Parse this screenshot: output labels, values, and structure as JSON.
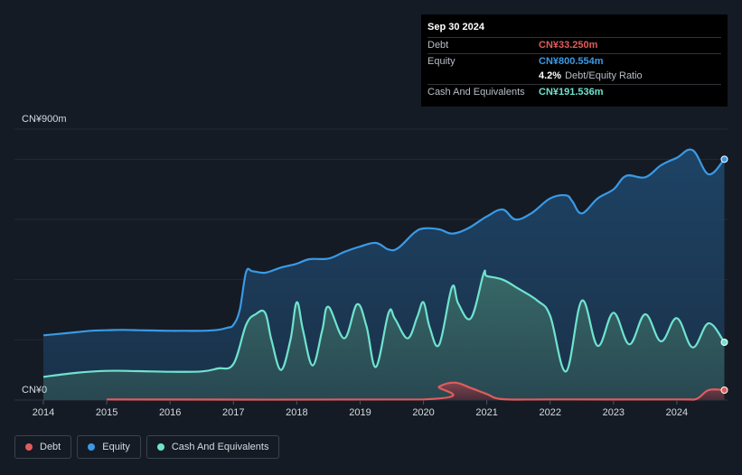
{
  "tooltip": {
    "date": "Sep 30 2024",
    "rows": [
      {
        "label": "Debt",
        "value": "CN¥33.250m",
        "color": "#e05c5c"
      },
      {
        "label": "Equity",
        "value": "CN¥800.554m",
        "color": "#3a9ae6"
      },
      {
        "label": "",
        "value": "4.2%",
        "suffix": "Debt/Equity Ratio",
        "color": "#ffffff"
      },
      {
        "label": "Cash And Equivalents",
        "value": "CN¥191.536m",
        "color": "#6fe3cf"
      }
    ]
  },
  "legend": [
    {
      "label": "Debt",
      "color": "#e05c5c"
    },
    {
      "label": "Equity",
      "color": "#3a9ae6"
    },
    {
      "label": "Cash And Equivalents",
      "color": "#6fe3cf"
    }
  ],
  "chart_data": {
    "type": "area",
    "y_top_label": "CN¥900m",
    "y_zero_label": "CN¥0",
    "ylim": [
      0,
      900
    ],
    "xlim": [
      2014.0,
      2024.8
    ],
    "x_ticks": [
      "2014",
      "2015",
      "2016",
      "2017",
      "2018",
      "2019",
      "2020",
      "2021",
      "2022",
      "2023",
      "2024"
    ],
    "series": [
      {
        "name": "Equity",
        "color": "#3a9ae6",
        "points": [
          [
            2014.0,
            215
          ],
          [
            2014.25,
            220
          ],
          [
            2014.5,
            225
          ],
          [
            2014.75,
            230
          ],
          [
            2015.0,
            232
          ],
          [
            2015.25,
            233
          ],
          [
            2015.5,
            232
          ],
          [
            2015.75,
            231
          ],
          [
            2016.0,
            230
          ],
          [
            2016.25,
            230
          ],
          [
            2016.5,
            230
          ],
          [
            2016.75,
            233
          ],
          [
            2016.9,
            240
          ],
          [
            2017.0,
            250
          ],
          [
            2017.1,
            300
          ],
          [
            2017.2,
            425
          ],
          [
            2017.3,
            428
          ],
          [
            2017.5,
            423
          ],
          [
            2017.75,
            440
          ],
          [
            2018.0,
            453
          ],
          [
            2018.2,
            468
          ],
          [
            2018.5,
            470
          ],
          [
            2018.75,
            492
          ],
          [
            2019.0,
            510
          ],
          [
            2019.25,
            522
          ],
          [
            2019.45,
            500
          ],
          [
            2019.6,
            505
          ],
          [
            2019.85,
            555
          ],
          [
            2020.0,
            570
          ],
          [
            2020.25,
            567
          ],
          [
            2020.45,
            553
          ],
          [
            2020.7,
            570
          ],
          [
            2021.0,
            610
          ],
          [
            2021.25,
            633
          ],
          [
            2021.45,
            600
          ],
          [
            2021.7,
            620
          ],
          [
            2022.0,
            670
          ],
          [
            2022.25,
            680
          ],
          [
            2022.35,
            660
          ],
          [
            2022.5,
            620
          ],
          [
            2022.75,
            670
          ],
          [
            2023.0,
            700
          ],
          [
            2023.2,
            745
          ],
          [
            2023.5,
            740
          ],
          [
            2023.75,
            780
          ],
          [
            2024.0,
            805
          ],
          [
            2024.25,
            830
          ],
          [
            2024.5,
            750
          ],
          [
            2024.75,
            800
          ]
        ]
      },
      {
        "name": "Cash And Equivalents",
        "color": "#6fe3cf",
        "points": [
          [
            2014.0,
            77
          ],
          [
            2014.5,
            90
          ],
          [
            2015.0,
            97
          ],
          [
            2015.5,
            96
          ],
          [
            2016.0,
            94
          ],
          [
            2016.5,
            95
          ],
          [
            2016.75,
            105
          ],
          [
            2017.0,
            120
          ],
          [
            2017.2,
            250
          ],
          [
            2017.35,
            285
          ],
          [
            2017.5,
            290
          ],
          [
            2017.6,
            200
          ],
          [
            2017.75,
            100
          ],
          [
            2017.9,
            200
          ],
          [
            2018.0,
            325
          ],
          [
            2018.1,
            230
          ],
          [
            2018.25,
            115
          ],
          [
            2018.4,
            230
          ],
          [
            2018.5,
            310
          ],
          [
            2018.75,
            205
          ],
          [
            2018.95,
            318
          ],
          [
            2019.1,
            245
          ],
          [
            2019.25,
            110
          ],
          [
            2019.45,
            290
          ],
          [
            2019.55,
            270
          ],
          [
            2019.75,
            205
          ],
          [
            2019.9,
            275
          ],
          [
            2020.0,
            325
          ],
          [
            2020.1,
            240
          ],
          [
            2020.25,
            185
          ],
          [
            2020.45,
            375
          ],
          [
            2020.55,
            320
          ],
          [
            2020.75,
            272
          ],
          [
            2020.95,
            420
          ],
          [
            2021.0,
            412
          ],
          [
            2021.25,
            400
          ],
          [
            2021.5,
            370
          ],
          [
            2021.8,
            330
          ],
          [
            2022.0,
            280
          ],
          [
            2022.25,
            95
          ],
          [
            2022.5,
            330
          ],
          [
            2022.75,
            180
          ],
          [
            2023.0,
            290
          ],
          [
            2023.25,
            185
          ],
          [
            2023.5,
            285
          ],
          [
            2023.75,
            195
          ],
          [
            2024.0,
            272
          ],
          [
            2024.25,
            175
          ],
          [
            2024.5,
            255
          ],
          [
            2024.75,
            192
          ]
        ]
      },
      {
        "name": "Debt",
        "color": "#e05c5c",
        "points": [
          [
            2015.0,
            2
          ],
          [
            2020.0,
            2
          ],
          [
            2020.25,
            45
          ],
          [
            2020.5,
            58
          ],
          [
            2020.75,
            40
          ],
          [
            2021.0,
            20
          ],
          [
            2021.25,
            3
          ],
          [
            2022.0,
            2
          ],
          [
            2024.0,
            2
          ],
          [
            2024.3,
            3
          ],
          [
            2024.5,
            33
          ],
          [
            2024.75,
            33
          ]
        ]
      }
    ]
  }
}
